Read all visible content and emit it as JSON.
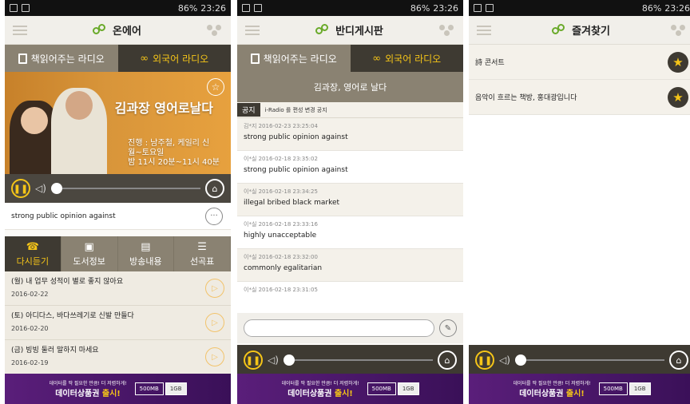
{
  "status": {
    "signal_text": "86%",
    "time": "23:26"
  },
  "panels": [
    {
      "app_title": "온에어",
      "tabs": [
        "책읽어주는 라디오",
        "외국어 라디오"
      ],
      "hero": {
        "title": "김과장 영어로날다",
        "info": [
          "진행 : 남주철, 케일리 신",
          "월~토요일",
          "밤 11시 20분~11시 40분"
        ]
      },
      "now_playing": "strong public opinion against",
      "subtabs": [
        "다시듣기",
        "도서정보",
        "방송내용",
        "선곡표"
      ],
      "episodes": [
        {
          "title": "(월) 내 업무 성적이 별로 좋지 않아요",
          "date": "2016-02-22"
        },
        {
          "title": "(토) 아디다스, 바다쓰레기로 신발 만들다",
          "date": "2016-02-20"
        },
        {
          "title": "(금) 빙빙 둘러 말하지 마세요",
          "date": "2016-02-19"
        }
      ]
    },
    {
      "app_title": "반디게시판",
      "tabs": [
        "책읽어주는 라디오",
        "외국어 라디오"
      ],
      "board_header": "김과장, 영어로 날다",
      "notice": {
        "badge": "공지",
        "text": "i-Radio 를 편성 변경 공지"
      },
      "posts": [
        {
          "meta": "김*지 2016-02-23 23:25:04",
          "text": "strong public opinion against"
        },
        {
          "meta": "이*실 2016-02-18 23:35:02",
          "text": "strong public opinion against"
        },
        {
          "meta": "이*실 2016-02-18 23:34:25",
          "text": "illegal bribed black market"
        },
        {
          "meta": "이*실 2016-02-18 23:33:16",
          "text": "highly unacceptable"
        },
        {
          "meta": "이*실 2016-02-18 23:32:00",
          "text": "commonly egalitarian"
        },
        {
          "meta": "이*실 2016-02-18 23:31:05",
          "text": ""
        }
      ]
    },
    {
      "app_title": "즐겨찾기",
      "favorites": [
        "詩 콘서트",
        "음악이 흐르는 책방, 홍대광입니다"
      ]
    }
  ],
  "banner": {
    "small": "데이터를 딱 필요한 만큼! 더 저렴하게!",
    "big_prefix": "데이터상품권",
    "big_suffix": "출시!",
    "box1": "500MB",
    "box2": "1GB"
  },
  "icons": {
    "accent": "#f5c518",
    "brand_green": "#6aaa2a",
    "bar_dark": "#3e3a32",
    "bar_mid": "#8a8272"
  }
}
